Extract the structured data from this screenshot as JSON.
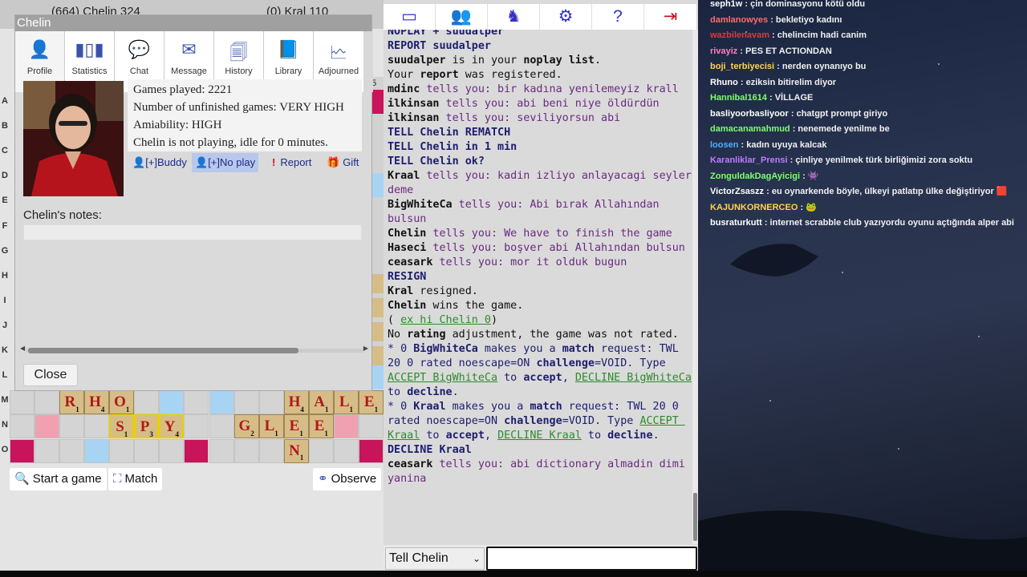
{
  "players": {
    "left": "(664) Chelin 324",
    "right": "(0) Kral 110"
  },
  "dialog": {
    "title": "Chelin",
    "tabs": [
      {
        "label": "Profile",
        "icon": "person-icon"
      },
      {
        "label": "Statistics",
        "icon": "bar-chart-icon"
      },
      {
        "label": "Chat",
        "icon": "chat-bubble-icon"
      },
      {
        "label": "Message",
        "icon": "envelope-icon"
      },
      {
        "label": "History",
        "icon": "documents-icon"
      },
      {
        "label": "Library",
        "icon": "book-icon"
      },
      {
        "label": "Adjourned",
        "icon": "chart-doc-icon"
      }
    ],
    "info": [
      "Games played: 2221",
      "Number of unfinished games: VERY HIGH",
      "Amiability: HIGH",
      "Chelin is not playing, idle for 0 minutes."
    ],
    "actions": {
      "buddy": "[+]Buddy",
      "noplay": "[+]No play",
      "report": "Report",
      "gift": "Gift"
    },
    "notes_label": "Chelin's notes:",
    "close": "Close"
  },
  "board_side": {
    "row_letters": [
      "A",
      "B",
      "C",
      "D",
      "E",
      "F",
      "G",
      "H",
      "I",
      "J",
      "K",
      "L",
      "M",
      "N",
      "O"
    ],
    "col_number": "5"
  },
  "buttons": {
    "start": "Start a game",
    "match": "Match",
    "observe": "Observe"
  },
  "toolbar_icons": [
    "window-icon",
    "users-icon",
    "horse-icon",
    "gear-icon",
    "help-icon",
    "logout-icon"
  ],
  "chat_input": {
    "select": "Tell Chelin",
    "select_arrow": "⌄"
  },
  "chat_log": [
    "NOPLAY + suudalper",
    "REPORT suudalper",
    "suudalper is in your noplay list.",
    "Your report was registered.",
    "mdinc tells you: bir kadına yenilemeyiz krall",
    "ilkinsan tells you: abi beni niye öldürdün",
    "ilkinsan tells you: seviliyorsun abi",
    "TELL Chelin REMATCH",
    "TELL Chelin in 1 min",
    "TELL Chelin ok?",
    "Kraal tells you: kadin izliyo anlayacagi seyler deme",
    "BigWhiteCa tells you: Abi bırak Allahından bulsun",
    "Chelin tells you: We have to finish the game",
    "Haseci tells you: boşver abi Allahından bulsun",
    "ceasark tells you: mor it olduk bugun",
    "RESIGN",
    "Kral resigned.",
    "Chelin wins the game.",
    "( ex hi Chelin 0)",
    "No rating adjustment, the game was not rated.",
    "* 0 BigWhiteCa makes you a match request: TWL 20 0 rated noescape=ON challenge=VOID. Type ACCEPT BigWhiteCa to accept, DECLINE BigWhiteCa to decline.",
    "* 0 Kraal makes you a match request: TWL 20 0 rated noescape=ON challenge=VOID. Type ACCEPT Kraal to accept, DECLINE Kraal to decline.",
    "DECLINE Kraal",
    "ceasark tells you: abi dictionary almadin dimi yanina"
  ],
  "twitch_chat": [
    {
      "user": "seph1w",
      "color": "#ffffff",
      "msg": "çin dominasyonu kötü oldu"
    },
    {
      "user": "damlanowyes",
      "color": "#ff6b6b",
      "msg": "bekletiyo kadını"
    },
    {
      "user": "wazbilenavam",
      "color": "#e8323c",
      "msg": "chelincim hadi canim"
    },
    {
      "user": "rivayiz",
      "color": "#ff7fbf",
      "msg": "PES ET ACTIONDAN"
    },
    {
      "user": "boji_terbiyecisi",
      "color": "#ffd24a",
      "msg": "nerden oynanıyo bu"
    },
    {
      "user": "Rhuno",
      "color": "#ffffff",
      "msg": "eziksin bitirelim diyor"
    },
    {
      "user": "Hannibal1614",
      "color": "#7dff6a",
      "msg": "VİLLAGE"
    },
    {
      "user": "basliyoorbasliyoor",
      "color": "#ffffff",
      "msg": "chatgpt prompt giriyo"
    },
    {
      "user": "damacanamahmud",
      "color": "#7dff6a",
      "msg": "nenemede yenilme be"
    },
    {
      "user": "loosen",
      "color": "#4ab0ff",
      "msg": "kadın uyuya kalcak"
    },
    {
      "user": "Karanliklar_Prensi",
      "color": "#c07aff",
      "msg": "çinliye yenilmek türk birliğimizi zora soktu"
    },
    {
      "user": "ZonguldakDagAyicigi",
      "color": "#7dff6a",
      "msg": "👾"
    },
    {
      "user": "VictorZsaszz",
      "color": "#ffffff",
      "msg": "eu oynarkende böyle, ülkeyi patlatıp ülke değiştiriyor 🟥"
    },
    {
      "user": "KAJUNKORNERCEO",
      "color": "#ffd24a",
      "msg": "🐸"
    },
    {
      "user": "busraturkutt",
      "color": "#ffffff",
      "msg": "internet scrabble club yazıyordu oyunu açtığında alper abi"
    }
  ]
}
